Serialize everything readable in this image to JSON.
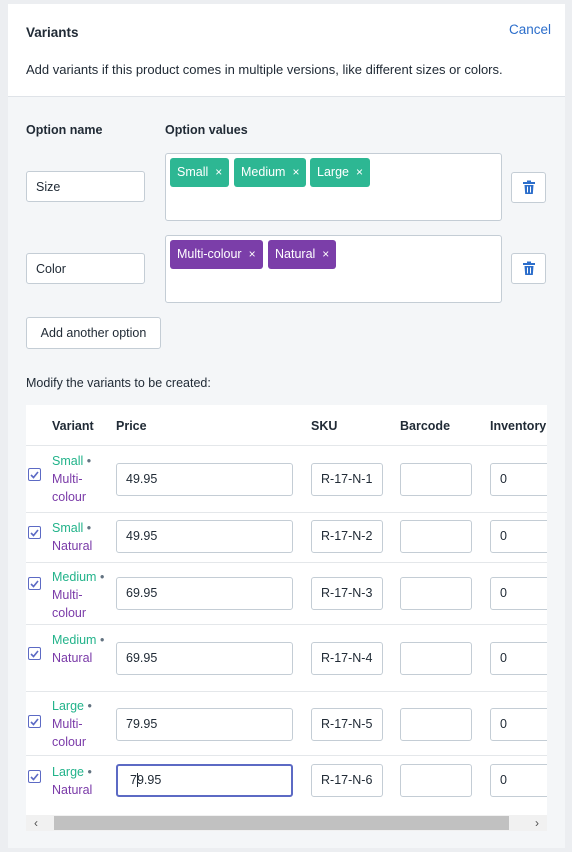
{
  "header": {
    "title": "Variants",
    "cancel_label": "Cancel",
    "description": "Add variants if this product comes in multiple versions, like different sizes or colors."
  },
  "options_section": {
    "option_name_label": "Option name",
    "option_values_label": "Option values",
    "options": [
      {
        "name": "Size",
        "values": [
          "Small",
          "Medium",
          "Large"
        ],
        "tag_color": "#2db793"
      },
      {
        "name": "Color",
        "values": [
          "Multi-colour",
          "Natural"
        ],
        "tag_color": "#7b3ea9"
      }
    ],
    "add_option_label": "Add another option",
    "tag_remove_glyph": "×",
    "delete_icon": "trash-icon"
  },
  "variants_section": {
    "intro": "Modify the variants to be created:",
    "columns": [
      "Variant",
      "Price",
      "SKU",
      "Barcode",
      "Inventory"
    ],
    "rows": [
      {
        "checked": true,
        "size": "Small",
        "color": "Multi-colour",
        "price": "49.95",
        "sku": "R-17-N-1",
        "barcode": "",
        "inventory": "0"
      },
      {
        "checked": true,
        "size": "Small",
        "color": "Natural",
        "price": "49.95",
        "sku": "R-17-N-2",
        "barcode": "",
        "inventory": "0"
      },
      {
        "checked": true,
        "size": "Medium",
        "color": "Multi-colour",
        "price": "69.95",
        "sku": "R-17-N-3",
        "barcode": "",
        "inventory": "0"
      },
      {
        "checked": true,
        "size": "Medium",
        "color": "Natural",
        "price": "69.95",
        "sku": "R-17-N-4",
        "barcode": "",
        "inventory": "0"
      },
      {
        "checked": true,
        "size": "Large",
        "color": "Multi-colour",
        "price": "79.95",
        "sku": "R-17-N-5",
        "barcode": "",
        "inventory": "0"
      },
      {
        "checked": true,
        "size": "Large",
        "color": "Natural",
        "price": "79.95",
        "sku": "R-17-N-6",
        "barcode": "",
        "inventory": "0"
      }
    ],
    "separator": "•"
  },
  "colors": {
    "accent": "#5c6ac4",
    "link": "#2c6ecb",
    "size_tag": "#2db793",
    "color_tag": "#7b3ea9",
    "size_text": "#22b38a",
    "color_text": "#7a3aa8"
  }
}
